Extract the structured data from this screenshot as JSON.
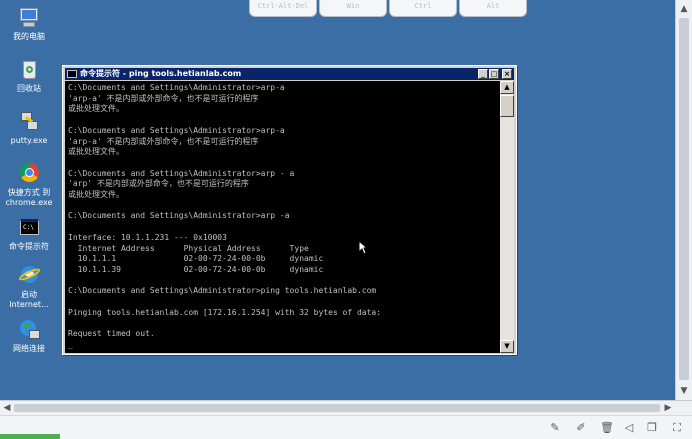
{
  "toolbar_keys": [
    "Ctrl-Alt-Del",
    "Win",
    "Ctrl",
    "Alt"
  ],
  "desktop_icons": [
    {
      "label": "我的电脑",
      "icon": "computer-icon"
    },
    {
      "label": "回收站",
      "icon": "recycle-bin-icon"
    },
    {
      "label": "putty.exe",
      "icon": "putty-icon"
    },
    {
      "label": "快捷方式 到\nchrome.exe",
      "icon": "chrome-icon"
    },
    {
      "label": "命令提示符",
      "icon": "cmd-icon"
    },
    {
      "label": "启动\nInternet...",
      "icon": "internet-explorer-icon"
    },
    {
      "label": "网络连接",
      "icon": "network-connections-icon"
    }
  ],
  "cmd_window": {
    "title": "命令提示符 - ping tools.hetianlab.com",
    "lines": [
      "C:\\Documents and Settings\\Administrator>arp-a",
      "'arp-a' 不是内部或外部命令，也不是可运行的程序",
      "或批处理文件。",
      "",
      "C:\\Documents and Settings\\Administrator>arp-a",
      "'arp-a' 不是内部或外部命令，也不是可运行的程序",
      "或批处理文件。",
      "",
      "C:\\Documents and Settings\\Administrator>arp - a",
      "'arp' 不是内部或外部命令，也不是可运行的程序",
      "或批处理文件。",
      "",
      "C:\\Documents and Settings\\Administrator>arp -a",
      "",
      "Interface: 10.1.1.231 --- 0x10003",
      "  Internet Address      Physical Address      Type",
      "  10.1.1.1              02-00-72-24-00-0b     dynamic",
      "  10.1.1.39             02-00-72-24-00-0b     dynamic",
      "",
      "C:\\Documents and Settings\\Administrator>ping tools.hetianlab.com",
      "",
      "Pinging tools.hetianlab.com [172.16.1.254] with 32 bytes of data:",
      "",
      "Request timed out.",
      "_"
    ]
  },
  "colors": {
    "desktop": "#3a6ea5",
    "titlebar": "#0a246a",
    "console_bg": "#000000",
    "console_text": "#c0c0c0"
  }
}
